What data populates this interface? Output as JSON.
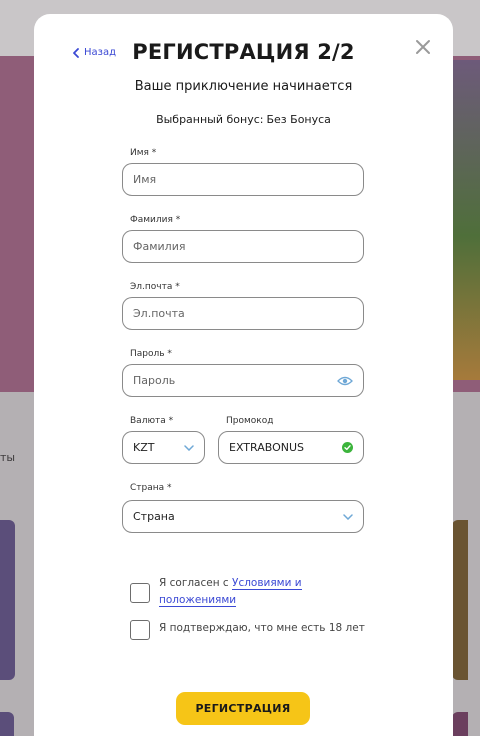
{
  "background": {
    "partial_text": "ты"
  },
  "modal": {
    "back_label": "Назад",
    "title": "РЕГИСТРАЦИЯ 2/2",
    "subtitle": "Ваше приключение начинается",
    "bonus_label": "Выбранный бонус:",
    "bonus_value": "Без Бонуса"
  },
  "form": {
    "name": {
      "label": "Имя *",
      "placeholder": "Имя",
      "value": ""
    },
    "surname": {
      "label": "Фамилия *",
      "placeholder": "Фамилия",
      "value": ""
    },
    "email": {
      "label": "Эл.почта *",
      "placeholder": "Эл.почта",
      "value": ""
    },
    "password": {
      "label": "Пароль *",
      "placeholder": "Пароль",
      "value": "",
      "toggle_icon": "eye-icon"
    },
    "currency": {
      "label": "Валюта *",
      "selected": "KZT"
    },
    "promo": {
      "label": "Промокод",
      "value": "EXTRABONUS",
      "status_icon": "check-circle-icon"
    },
    "country": {
      "label": "Страна *",
      "selected": "Страна"
    }
  },
  "checkboxes": {
    "terms_prefix": "Я согласен с ",
    "terms_link_line1": "Условиями и",
    "terms_link_line2": "положениями",
    "terms_checked": false,
    "age_text": "Я подтверждаю, что мне есть 18 лет",
    "age_checked": false
  },
  "submit_label": "РЕГИСТРАЦИЯ",
  "colors": {
    "accent_link": "#3b49d4",
    "button_bg": "#f6c517",
    "promo_ok": "#3cb43c",
    "eye_icon": "#6fa8d6"
  }
}
